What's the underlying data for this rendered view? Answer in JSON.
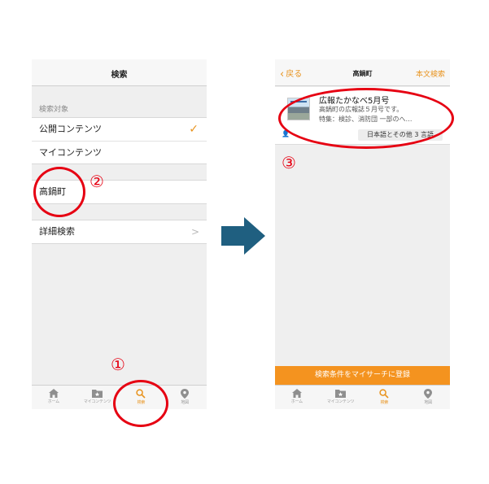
{
  "left_screen": {
    "header_title": "検索",
    "section_label": "検索対象",
    "options": [
      {
        "label": "公開コンテンツ",
        "selected": true
      },
      {
        "label": "マイコンテンツ",
        "selected": false
      }
    ],
    "search_value": "高鍋町",
    "detail_search_label": "詳細検索",
    "tabs": [
      {
        "label": "ホーム",
        "icon": "home-icon",
        "active": false
      },
      {
        "label": "マイコンテンツ",
        "icon": "folder-star-icon",
        "active": false
      },
      {
        "label": "検索",
        "icon": "search-icon",
        "active": true
      },
      {
        "label": "地図",
        "icon": "map-pin-icon",
        "active": false
      }
    ]
  },
  "right_screen": {
    "back_label": "戻る",
    "header_title": "高鍋町",
    "fulltext_label": "本文検索",
    "result": {
      "title": "広報たかなべ5月号",
      "line1": "高鍋町の広報誌５月号です。",
      "line2": "特集：検診、消防団 一部のへ…",
      "tag": "日本語とその他 3 言語"
    },
    "register_label": "検索条件をマイサーチに登録",
    "tabs": [
      {
        "label": "ホーム",
        "icon": "home-icon",
        "active": false
      },
      {
        "label": "マイコンテンツ",
        "icon": "folder-star-icon",
        "active": false
      },
      {
        "label": "検索",
        "icon": "search-icon",
        "active": true
      },
      {
        "label": "地図",
        "icon": "map-pin-icon",
        "active": false
      }
    ]
  },
  "annotations": {
    "marker1": "①",
    "marker2": "②",
    "marker3": "③"
  },
  "colors": {
    "accent": "#e8931e",
    "register_bar": "#f4931f",
    "annotation_red": "#e60012",
    "arrow": "#1f5f80"
  }
}
